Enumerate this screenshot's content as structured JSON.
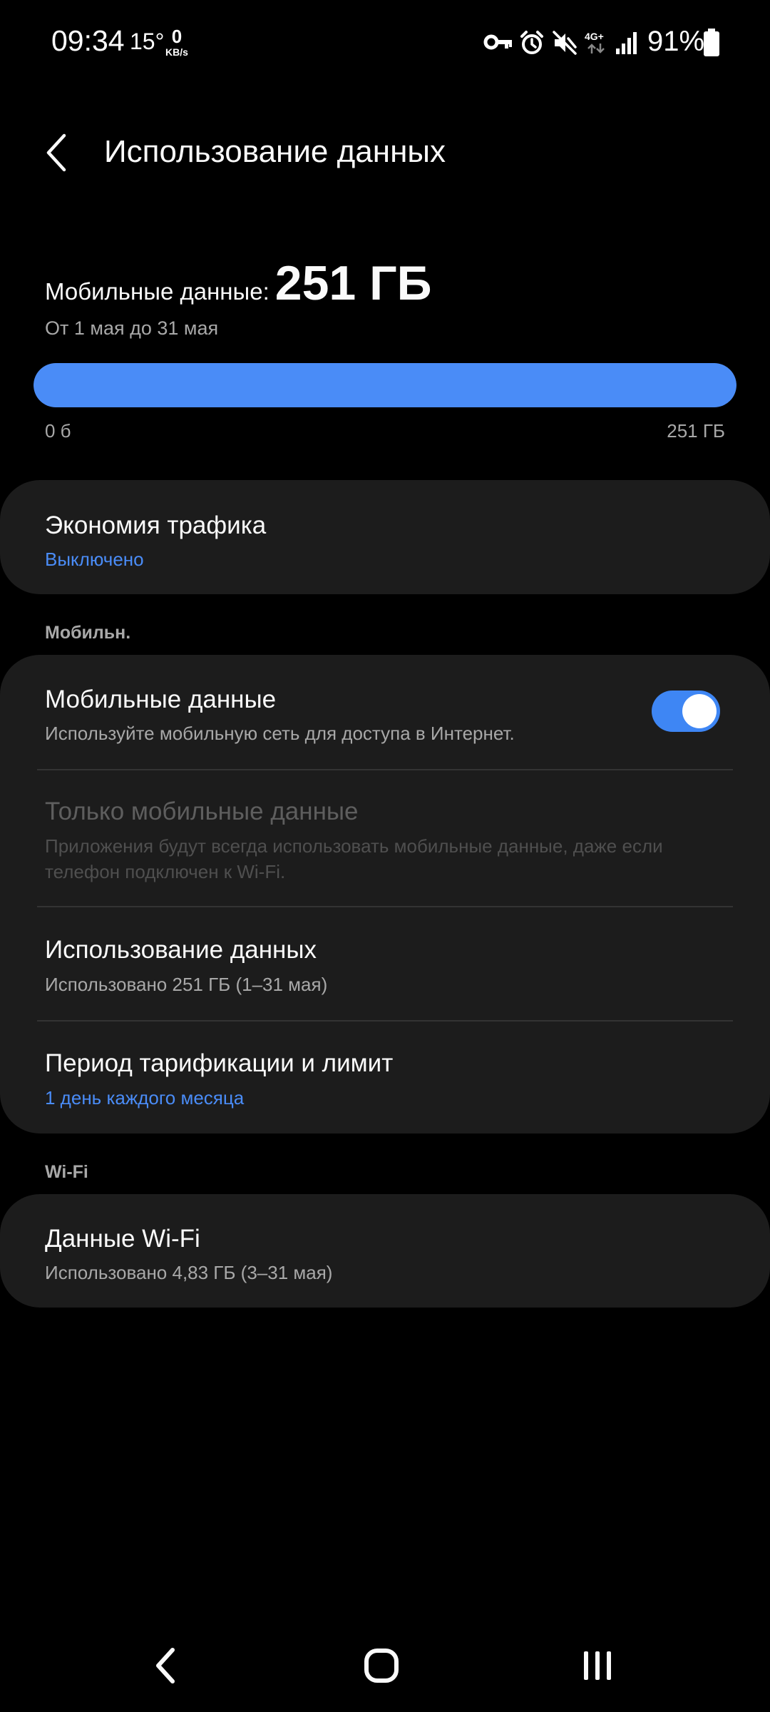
{
  "status_bar": {
    "time": "09:34",
    "temperature": "15°",
    "net_speed_value": "0",
    "net_speed_unit": "KB/s",
    "network_type": "4G+",
    "battery_percent": "91%",
    "icons": [
      "vpn-key-icon",
      "alarm-icon",
      "vibrate-mute-icon",
      "data-arrows-icon",
      "signal-icon",
      "battery-icon"
    ]
  },
  "header": {
    "title": "Использование данных"
  },
  "summary": {
    "label": "Мобильные данные:",
    "value": "251 ГБ",
    "period": "От 1 мая до 31 мая",
    "bar_fill_fraction": 1.0,
    "bar_min": "0 б",
    "bar_max": "251 ГБ"
  },
  "saver": {
    "title": "Экономия трафика",
    "status": "Выключено"
  },
  "mobile_section": {
    "label": "Мобильн.",
    "items": [
      {
        "title": "Мобильные данные",
        "subtitle": "Используйте мобильную сеть для доступа в Интернет.",
        "toggle_on": true
      },
      {
        "title": "Только мобильные данные",
        "subtitle": "Приложения будут всегда использовать мобильные данные, даже если телефон подключен к Wi-Fi.",
        "disabled": true
      },
      {
        "title": "Использование данных",
        "subtitle": "Использовано 251 ГБ (1–31 мая)"
      },
      {
        "title": "Период тарификации и лимит",
        "subtitle": "1 день каждого месяца"
      }
    ]
  },
  "wifi_section": {
    "label": "Wi-Fi",
    "items": [
      {
        "title": "Данные Wi-Fi",
        "subtitle": "Использовано 4,83 ГБ (3–31 мая)"
      }
    ]
  },
  "colors": {
    "accent": "#4a8cf7",
    "card": "#1c1c1c",
    "background": "#000000",
    "secondary_text": "#a8a8a8"
  },
  "nav_bar": {
    "buttons": [
      "back",
      "home",
      "recents"
    ]
  }
}
